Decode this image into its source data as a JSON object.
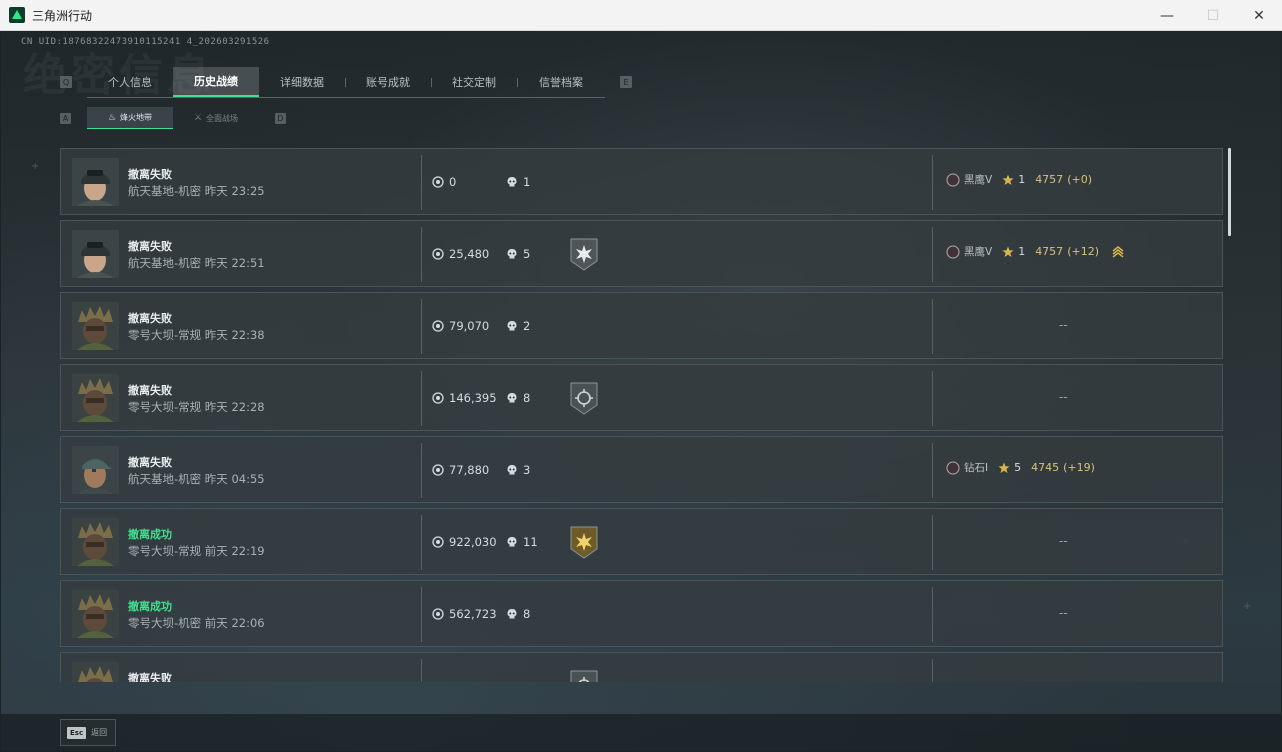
{
  "window": {
    "title": "三角洲行动",
    "minimize": "—",
    "maximize": "☐",
    "close": "✕"
  },
  "game": {
    "uid": "CN UID:18768322473910115241 4_202603291526",
    "bg_title": "绝密信息",
    "tab_key_left": "Q",
    "tab_key_right": "E",
    "subtab_key_left": "A",
    "subtab_key_right": "D",
    "tabs": [
      {
        "label": "个人信息",
        "active": false
      },
      {
        "label": "历史战绩",
        "active": true
      },
      {
        "label": "详细数据",
        "active": false
      },
      {
        "label": "账号成就",
        "active": false
      },
      {
        "label": "社交定制",
        "active": false
      },
      {
        "label": "信誉档案",
        "active": false
      }
    ],
    "subtabs": [
      {
        "label": "烽火地带",
        "icon": "flame-zone-icon",
        "active": true
      },
      {
        "label": "全面战场",
        "icon": "battlefield-icon",
        "active": false
      }
    ],
    "matches": [
      {
        "result": "撤离失败",
        "success": false,
        "map": "航天基地-机密 昨天 23:25",
        "avatar": "helmet-soldier",
        "value": "0",
        "kills": "1",
        "badge": null,
        "rank": {
          "icon": "V",
          "name": "黑鹰V",
          "stars": "1",
          "score": "4757",
          "delta": "(+0)",
          "promo": false
        }
      },
      {
        "result": "撤离失败",
        "success": false,
        "map": "航天基地-机密 昨天 22:51",
        "avatar": "helmet-soldier",
        "value": "25,480",
        "kills": "5",
        "badge": "star-burst",
        "rank": {
          "icon": "V",
          "name": "黑鹰V",
          "stars": "1",
          "score": "4757",
          "delta": "(+12)",
          "promo": true
        }
      },
      {
        "result": "撤离失败",
        "success": false,
        "map": "零号大坝-常规 昨天 22:38",
        "avatar": "ghillie-soldier",
        "value": "79,070",
        "kills": "2",
        "badge": null,
        "rank": null
      },
      {
        "result": "撤离失败",
        "success": false,
        "map": "零号大坝-常规 昨天 22:28",
        "avatar": "ghillie-soldier",
        "value": "146,395",
        "kills": "8",
        "badge": "crosshair",
        "rank": null
      },
      {
        "result": "撤离失败",
        "success": false,
        "map": "航天基地-机密 昨天 04:55",
        "avatar": "cap-soldier",
        "value": "77,880",
        "kills": "3",
        "badge": null,
        "rank": {
          "icon": "I",
          "name": "钻石I",
          "stars": "5",
          "score": "4745",
          "delta": "(+19)",
          "promo": false
        }
      },
      {
        "result": "撤离成功",
        "success": true,
        "map": "零号大坝-常规 前天 22:19",
        "avatar": "ghillie-soldier",
        "value": "922,030",
        "kills": "11",
        "badge": "gold-burst",
        "rank": null
      },
      {
        "result": "撤离成功",
        "success": true,
        "map": "零号大坝-机密 前天 22:06",
        "avatar": "ghillie-soldier",
        "value": "562,723",
        "kills": "8",
        "badge": null,
        "rank": null
      },
      {
        "result": "撤离失败",
        "success": false,
        "map": "",
        "avatar": "ghillie-soldier",
        "value": "",
        "kills": "",
        "badge": "crosshair",
        "rank": null
      }
    ],
    "empty_rank": "--",
    "esc_key": "Esc",
    "esc_label": "返回"
  }
}
